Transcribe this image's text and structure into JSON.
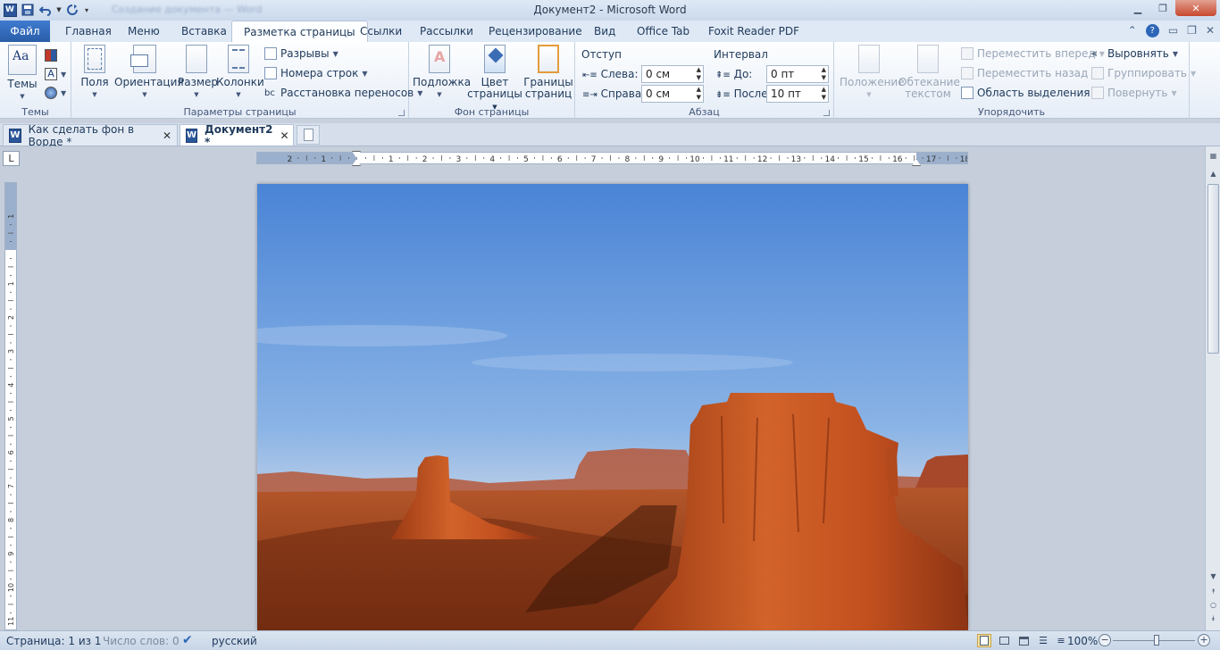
{
  "window": {
    "title": "Документ2 - Microsoft Word",
    "qat_blurred": "Создание документа — Word"
  },
  "ribbon_tabs": {
    "file": "Файл",
    "tabs": [
      "Главная",
      "Меню",
      "Вставка",
      "Разметка страницы",
      "Ссылки",
      "Рассылки",
      "Рецензирование",
      "Вид",
      "Office Tab",
      "Foxit Reader PDF"
    ],
    "active": "Разметка страницы"
  },
  "groups": {
    "themes": {
      "label": "Темы",
      "themes_button": "Темы"
    },
    "page_setup": {
      "label": "Параметры страницы",
      "margins": "Поля",
      "orientation": "Ориентация",
      "size": "Размер",
      "columns": "Колонки",
      "breaks": "Разрывы",
      "line_numbers": "Номера строк",
      "hyphenation": "Расстановка переносов"
    },
    "page_background": {
      "label": "Фон страницы",
      "watermark": "Подложка",
      "page_color_1": "Цвет",
      "page_color_2": "страницы",
      "page_borders_1": "Границы",
      "page_borders_2": "страниц"
    },
    "paragraph": {
      "label": "Абзац",
      "indent_title": "Отступ",
      "left_label": "Слева:",
      "left_value": "0 см",
      "right_label": "Справа:",
      "right_value": "0 см",
      "spacing_title": "Интервал",
      "before_label": "До:",
      "before_value": "0 пт",
      "after_label": "После:",
      "after_value": "10 пт"
    },
    "arrange": {
      "label": "Упорядочить",
      "position": "Положение",
      "wrap_1": "Обтекание",
      "wrap_2": "текстом",
      "bring_forward": "Переместить вперед",
      "send_backward": "Переместить назад",
      "selection_pane": "Область выделения",
      "align": "Выровнять",
      "group": "Группировать",
      "rotate": "Повернуть"
    }
  },
  "doc_tabs": [
    {
      "title": "Как сделать фон в Ворде *",
      "active": false
    },
    {
      "title": "Документ2 *",
      "active": true
    }
  ],
  "statusbar": {
    "page": "Страница: 1 из 1",
    "words": "Число слов: 0",
    "language": "русский",
    "zoom": "100%"
  },
  "colors": {
    "file_tab": "#2a5ea8",
    "sky_top": "#4a84d6",
    "rock": "#b5451c"
  }
}
